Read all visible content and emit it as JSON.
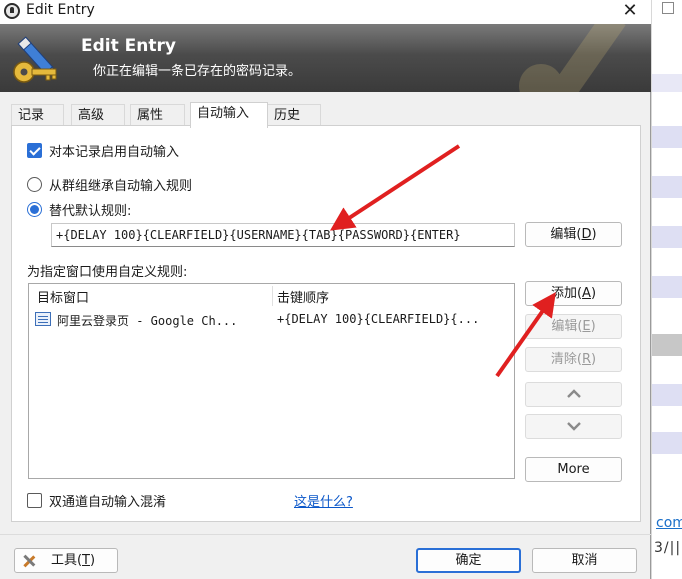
{
  "window": {
    "title": "Edit Entry",
    "close_glyph": "✕"
  },
  "banner": {
    "title": "Edit Entry",
    "subtitle": "你正在编辑一条已存在的密码记录。"
  },
  "tabs": [
    {
      "label": "记录",
      "active": false
    },
    {
      "label": "高级",
      "active": false
    },
    {
      "label": "属性",
      "active": false
    },
    {
      "label": "自动输入",
      "active": true
    },
    {
      "label": "历史",
      "active": false
    }
  ],
  "autotype": {
    "enable_label": "对本记录启用自动输入",
    "enable_checked": true,
    "inherit_label": "从群组继承自动输入规则",
    "inherit_selected": false,
    "override_label": "替代默认规则:",
    "override_selected": true,
    "sequence_value": "+{DELAY 100}{CLEARFIELD}{USERNAME}{TAB}{PASSWORD}{ENTER}",
    "edit_button": "编辑(D)",
    "custom_label": "为指定窗口使用自定义规则:",
    "list_columns": [
      "目标窗口",
      "击键顺序"
    ],
    "list_rows": [
      {
        "target": "阿里云登录页 - Google Ch...",
        "sequence": "+{DELAY 100}{CLEARFIELD}{..."
      }
    ],
    "add_button": "添加(A)",
    "edit_item_button": "编辑(E)",
    "delete_button": "清除(R)",
    "more_button": "More",
    "obfuscation_label": "双通道自动输入混淆",
    "obfuscation_checked": false,
    "whats_this_link": "这是什么?"
  },
  "footer": {
    "tools_button": "工具(T)",
    "ok_button": "确定",
    "cancel_button": "取消"
  },
  "background_app": {
    "link_text": "com",
    "slashes_text": "3/||"
  },
  "icons": {
    "app_icon": "keepass-lock-icon",
    "banner_icon": "key-pen-icon",
    "row_icon": "window-list-icon",
    "up_arrow": "chevron-up-icon",
    "down_arrow": "chevron-down-icon",
    "tools_icon": "tools-icon"
  },
  "colors": {
    "accent": "#2a6fd6",
    "banner_dark": "#3a3a3a",
    "annotation_red": "#e02020",
    "link": "#0b57c9"
  }
}
